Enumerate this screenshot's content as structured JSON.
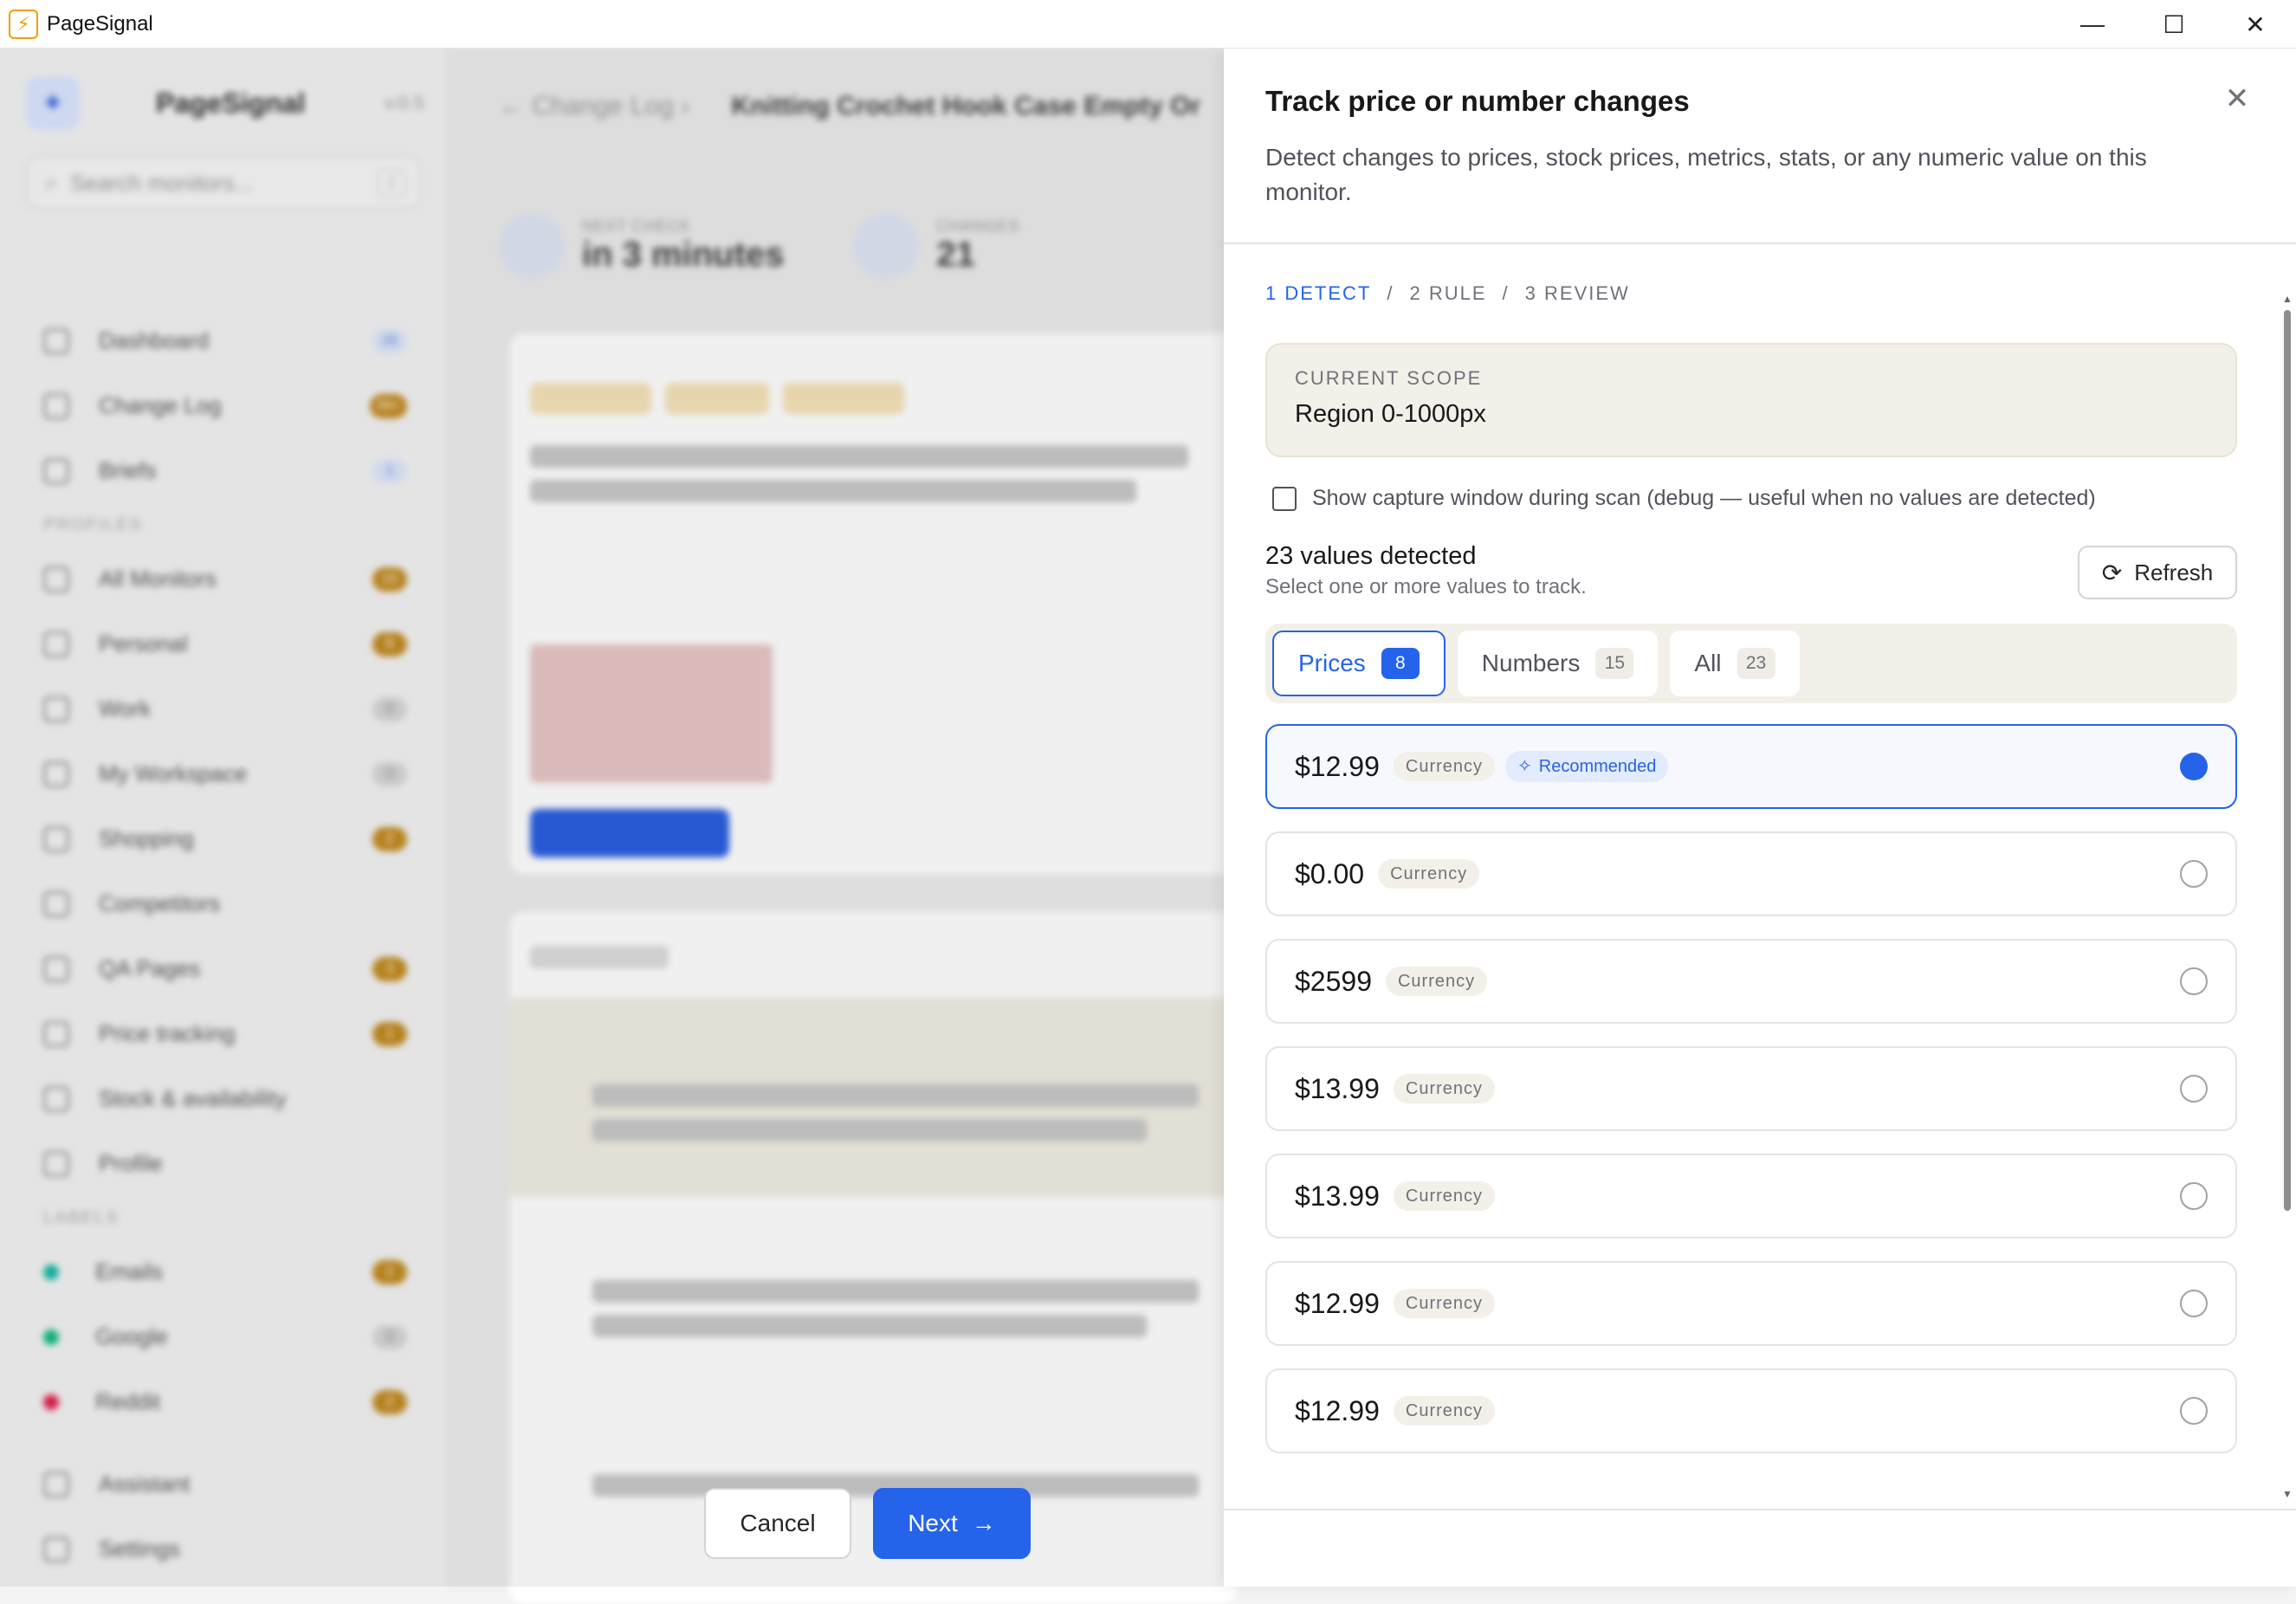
{
  "window": {
    "title": "PageSignal",
    "controls": [
      "—",
      "☐",
      "✕"
    ]
  },
  "background": {
    "brand": "PageSignal",
    "version": "v.0.5",
    "search_placeholder": "Search monitors...",
    "search_kbd": "/",
    "nav": [
      {
        "label": "Dashboard",
        "badge": "28"
      },
      {
        "label": "Change Log",
        "badge": "99+"
      },
      {
        "label": "Briefs",
        "badge": "1"
      }
    ],
    "profiles_heading": "PROFILES",
    "profiles": [
      {
        "label": "All Monitors",
        "badge": "15"
      },
      {
        "label": "Personal",
        "badge": "8"
      },
      {
        "label": "Work",
        "badge": "0"
      },
      {
        "label": "My Workspace",
        "badge": "0"
      },
      {
        "label": "Shopping",
        "badge": "2"
      },
      {
        "label": "Competitors",
        "badge": ""
      },
      {
        "label": "QA Pages",
        "badge": "3"
      },
      {
        "label": "Price tracking",
        "badge": "1"
      },
      {
        "label": "Stock & availability",
        "badge": ""
      },
      {
        "label": "Profile",
        "badge": ""
      }
    ],
    "labels_heading": "LABELS",
    "labels": [
      {
        "label": "Emails",
        "badge": "2",
        "color": "#14b8a6"
      },
      {
        "label": "Google",
        "badge": "0",
        "color": "#10b981"
      },
      {
        "label": "Reddit",
        "badge": "2",
        "color": "#e11d48"
      }
    ],
    "footer_items": [
      "Assistant",
      "Settings"
    ],
    "breadcrumb": {
      "parent": "Change Log",
      "current": "Knitting Crochet Hook Case Empty Or"
    },
    "stats": [
      {
        "label": "NEXT CHECK",
        "value": "in 3 minutes"
      },
      {
        "label": "CHANGES",
        "value": "21"
      }
    ]
  },
  "dialog": {
    "title": "Track price or number changes",
    "description": "Detect changes to prices, stock prices, metrics, stats, or any numeric value on this monitor.",
    "close_glyph": "✕",
    "steps": [
      {
        "label": "1 DETECT",
        "active": true
      },
      {
        "label": "2 RULE",
        "active": false
      },
      {
        "label": "3 REVIEW",
        "active": false
      }
    ],
    "step_separator": "/",
    "scope": {
      "label": "CURRENT SCOPE",
      "value": "Region 0-1000px"
    },
    "debug_checkbox": {
      "label": "Show capture window during scan (debug — useful when no values are detected)",
      "checked": false
    },
    "detected": {
      "title": "23 values detected",
      "subtitle": "Select one or more values to track."
    },
    "refresh_label": "Refresh",
    "tabs": [
      {
        "label": "Prices",
        "count": "8",
        "active": true
      },
      {
        "label": "Numbers",
        "count": "15",
        "active": false
      },
      {
        "label": "All",
        "count": "23",
        "active": false
      }
    ],
    "values": [
      {
        "amount": "$12.99",
        "type": "Currency",
        "recommended": "Recommended",
        "selected": true
      },
      {
        "amount": "$0.00",
        "type": "Currency",
        "selected": false
      },
      {
        "amount": "$2599",
        "type": "Currency",
        "selected": false
      },
      {
        "amount": "$13.99",
        "type": "Currency",
        "selected": false
      },
      {
        "amount": "$13.99",
        "type": "Currency",
        "selected": false
      },
      {
        "amount": "$12.99",
        "type": "Currency",
        "selected": false
      },
      {
        "amount": "$12.99",
        "type": "Currency",
        "selected": false
      }
    ],
    "cancel_label": "Cancel",
    "next_label": "Next",
    "accent_color": "#2563eb"
  }
}
